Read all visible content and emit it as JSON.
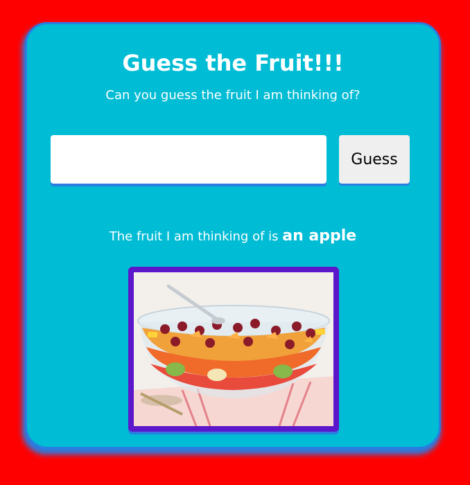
{
  "header": {
    "title": "Guess the Fruit!!!",
    "subtitle": "Can you guess the fruit I am thinking of?"
  },
  "guess_form": {
    "input_value": "",
    "button_label": "Guess"
  },
  "answer": {
    "prefix": "The fruit I am thinking of is",
    "value": "an apple"
  },
  "image": {
    "subject": "fruit-salad-bowl"
  },
  "colors": {
    "page_background": "#ff0000",
    "card_background": "#00bcd4",
    "card_border": "#2a7de1",
    "image_frame": "#5b17c9"
  }
}
